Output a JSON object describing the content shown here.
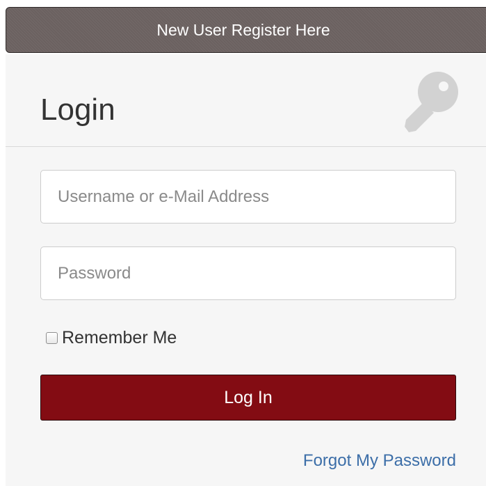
{
  "register": {
    "label": "New User Register Here"
  },
  "login": {
    "title": "Login",
    "icon": "key-icon",
    "username_placeholder": "Username or e-Mail Address",
    "password_placeholder": "Password",
    "remember_label": "Remember Me",
    "remember_checked": false,
    "submit_label": "Log In",
    "forgot_label": "Forgot My Password"
  },
  "colors": {
    "register_bar": "#6b6160",
    "panel_background": "#f6f6f6",
    "submit_button": "#830c13",
    "link": "#3c6ea8",
    "key_icon": "#d2d2d2"
  }
}
